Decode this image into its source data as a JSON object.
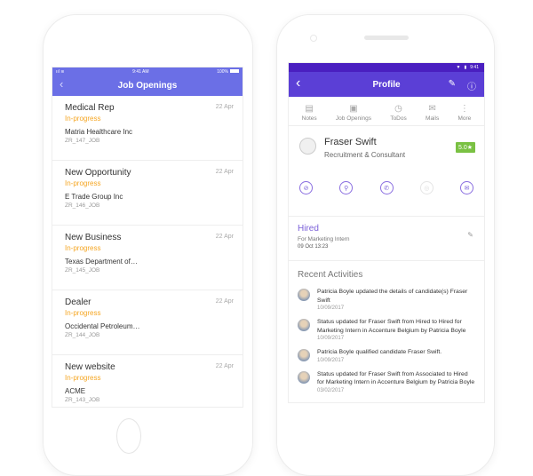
{
  "ios": {
    "status": {
      "time": "9:41 AM",
      "battery": "100%",
      "signal": "signal-icon",
      "wifi": "wifi-icon"
    },
    "nav": {
      "back": "‹",
      "title": "Job Openings"
    },
    "jobs": [
      {
        "title": "Medical Rep",
        "date": "22 Apr",
        "status": "In-progress",
        "company": "Matria Healthcare Inc",
        "id": "ZR_147_JOB"
      },
      {
        "title": "New Opportunity",
        "date": "22 Apr",
        "status": "In-progress",
        "company": "E Trade Group Inc",
        "id": "ZR_146_JOB"
      },
      {
        "title": "New Business",
        "date": "22 Apr",
        "status": "In-progress",
        "company": "Texas Department of…",
        "id": "ZR_145_JOB"
      },
      {
        "title": "Dealer",
        "date": "22 Apr",
        "status": "In-progress",
        "company": "Occidental Petroleum…",
        "id": "ZR_144_JOB"
      },
      {
        "title": "New website",
        "date": "22 Apr",
        "status": "In-progress",
        "company": "ACME",
        "id": "ZR_143_JOB"
      }
    ]
  },
  "android": {
    "status": {
      "time": "9:41"
    },
    "nav": {
      "back": "‹",
      "title": "Profile",
      "edit_icon": "✎",
      "info_icon": "ⓘ"
    },
    "tabs": [
      {
        "label": "Notes",
        "icon": "▤"
      },
      {
        "label": "Job Openings",
        "icon": "▣"
      },
      {
        "label": "ToDos",
        "icon": "◷"
      },
      {
        "label": "Mails",
        "icon": "✉"
      },
      {
        "label": "More",
        "icon": "⋮"
      }
    ],
    "profile": {
      "name": "Fraser Swift",
      "role": "Recruitment & Consultant",
      "rating": "5.0★"
    },
    "actions": [
      {
        "name": "attachment",
        "glyph": "⊘"
      },
      {
        "name": "location",
        "glyph": "⚲"
      },
      {
        "name": "phone",
        "glyph": "✆"
      },
      {
        "name": "chat",
        "glyph": "◎"
      },
      {
        "name": "mail",
        "glyph": "✉"
      }
    ],
    "hired": {
      "status": "Hired",
      "for": "For Marketing Intern",
      "date": "09 Oct 13:23",
      "edit": "✎"
    },
    "recent_title": "Recent Activities",
    "activities": [
      {
        "text": "Patricia Boyle updated the details of candidate(s) Fraser Swift",
        "date": "10/09/2017"
      },
      {
        "text": "Status updated for Fraser Swift from Hired to Hired for Marketing Intern in Accenture Belgium by Patricia Boyle",
        "date": "10/09/2017"
      },
      {
        "text": "Patricia Boyle qualified candidate Fraser Swift.",
        "date": "10/09/2017"
      },
      {
        "text": "Status updated for Fraser Swift from Associated to Hired for Marketing Intern in Accenture Belgium by Patricia Boyle",
        "date": "03/02/2017"
      }
    ]
  }
}
